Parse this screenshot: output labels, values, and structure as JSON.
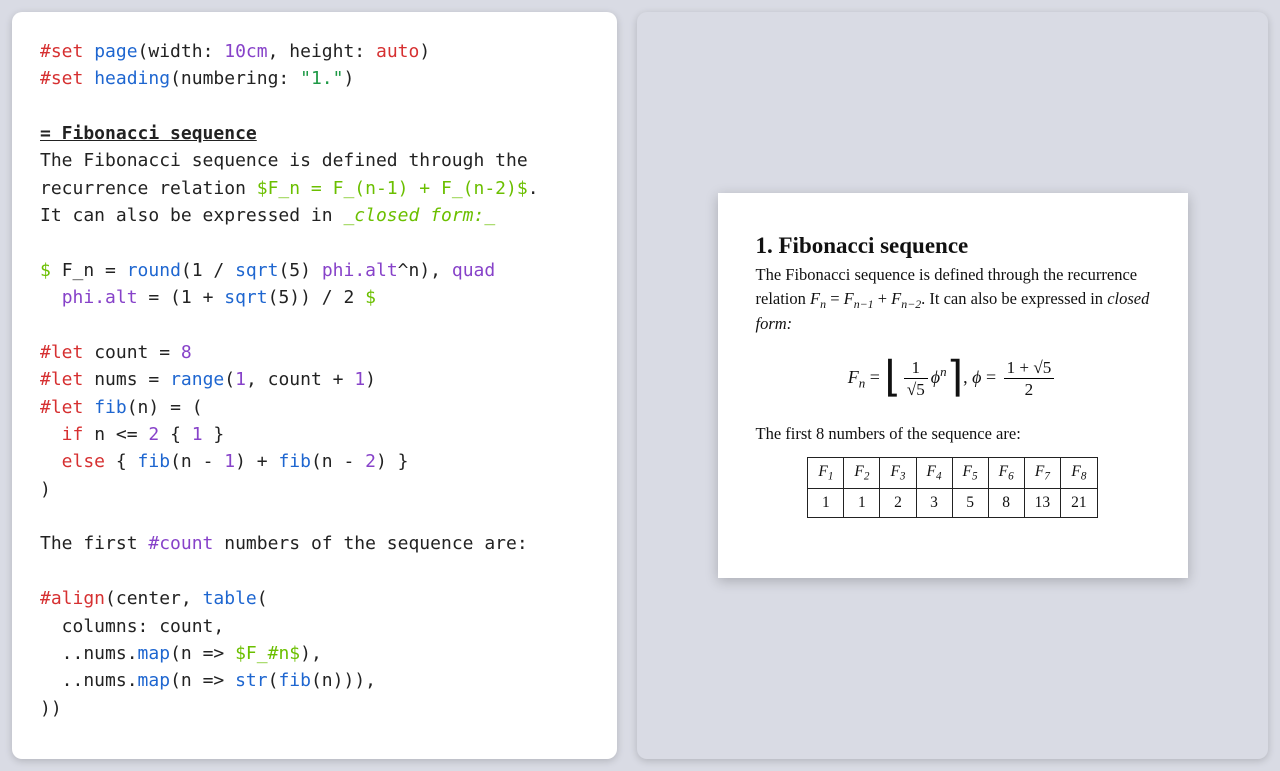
{
  "code": {
    "l1_pre1": "#set",
    "l1_fn": " page",
    "l1_mid1": "(width: ",
    "l1_num1": "10cm",
    "l1_mid2": ", height: ",
    "l1_kw": "auto",
    "l1_end": ")",
    "l2_pre": "#set",
    "l2_fn": " heading",
    "l2_mid": "(numbering: ",
    "l2_str": "\"1.\"",
    "l2_end": ")",
    "l4": "= Fibonacci sequence",
    "l5": "The Fibonacci sequence is defined through the",
    "l6a": "recurrence relation ",
    "l6b": "$F_n = F_(n-1) + F_(n-2)$",
    "l6c": ".",
    "l7a": "It can also be expressed in ",
    "l7b": "_closed form:_",
    "l9a": "$ ",
    "l9b": "F_n",
    "l9c": " = ",
    "l9_round": "round",
    "l9d": "(1 / ",
    "l9_sqrt": "sqrt",
    "l9e": "(5) ",
    "l9_phi": "phi.alt",
    "l9f": "^n), ",
    "l9_quad": "quad",
    "l10_phi": "phi.alt",
    "l10a": " = (1 + ",
    "l10_sqrt": "sqrt",
    "l10b": "(5)) / 2 ",
    "l10c": "$",
    "l12_pre": "#let",
    "l12_var": " count",
    "l12_eq": " = ",
    "l12_num": "8",
    "l13_pre": "#let",
    "l13_var": " nums",
    "l13_eq": " = ",
    "l13_fn": "range",
    "l13_args1": "(",
    "l13_n1": "1",
    "l13_args2": ", count + ",
    "l13_n2": "1",
    "l13_args3": ")",
    "l14_pre": "#let",
    "l14_fn": " fib",
    "l14_args": "(n) = (",
    "l15_if": "  if",
    "l15_cond": " n <= ",
    "l15_n": "2",
    "l15_body": " { ",
    "l15_val": "1",
    "l15_end": " }",
    "l16_else": "  else",
    "l16_body1": " { ",
    "l16_fib1": "fib",
    "l16_mid1": "(n - ",
    "l16_n1": "1",
    "l16_mid2": ") + ",
    "l16_fib2": "fib",
    "l16_mid3": "(n - ",
    "l16_n2": "2",
    "l16_mid4": ") }",
    "l17": ")",
    "l19a": "The first ",
    "l19b": "#count",
    "l19c": " numbers of the sequence are:",
    "l21_pre": "#align",
    "l21_args1": "(center, ",
    "l21_fn": "table",
    "l21_args2": "(",
    "l22": "  columns: count,",
    "l23a": "  ..nums.",
    "l23_map": "map",
    "l23b": "(n => ",
    "l23c": "$F_#n$",
    "l23d": "),",
    "l24a": "  ..nums.",
    "l24_map": "map",
    "l24b": "(n => ",
    "l24_str": "str",
    "l24c": "(",
    "l24_fib": "fib",
    "l24d": "(n))),",
    "l25": "))"
  },
  "preview": {
    "heading": "1. Fibonacci sequence",
    "p1a": "The Fibonacci sequence is defined through the recurrence relation ",
    "rec_F": "F",
    "rec_n": "n",
    "rec_eq": " = ",
    "rec_nm1": "n−1",
    "rec_plus": " + ",
    "rec_nm2": "n−2",
    "p1b": ". It can also be expressed in ",
    "p1c": "closed form:",
    "formula": {
      "Fn_F": "F",
      "Fn_n": "n",
      "eq1": " = ",
      "one": "1",
      "root5": "√5",
      "phi": "ϕ",
      "supn": "n",
      "comma": ",   ",
      "phi2": "ϕ",
      "eq2": " = ",
      "top": "1 + √5",
      "bot": "2"
    },
    "p2a": "The first 8 numbers of the sequence are:",
    "headers": [
      "F",
      "F",
      "F",
      "F",
      "F",
      "F",
      "F",
      "F"
    ],
    "subs": [
      "1",
      "2",
      "3",
      "4",
      "5",
      "6",
      "7",
      "8"
    ],
    "values": [
      "1",
      "1",
      "2",
      "3",
      "5",
      "8",
      "13",
      "21"
    ]
  }
}
